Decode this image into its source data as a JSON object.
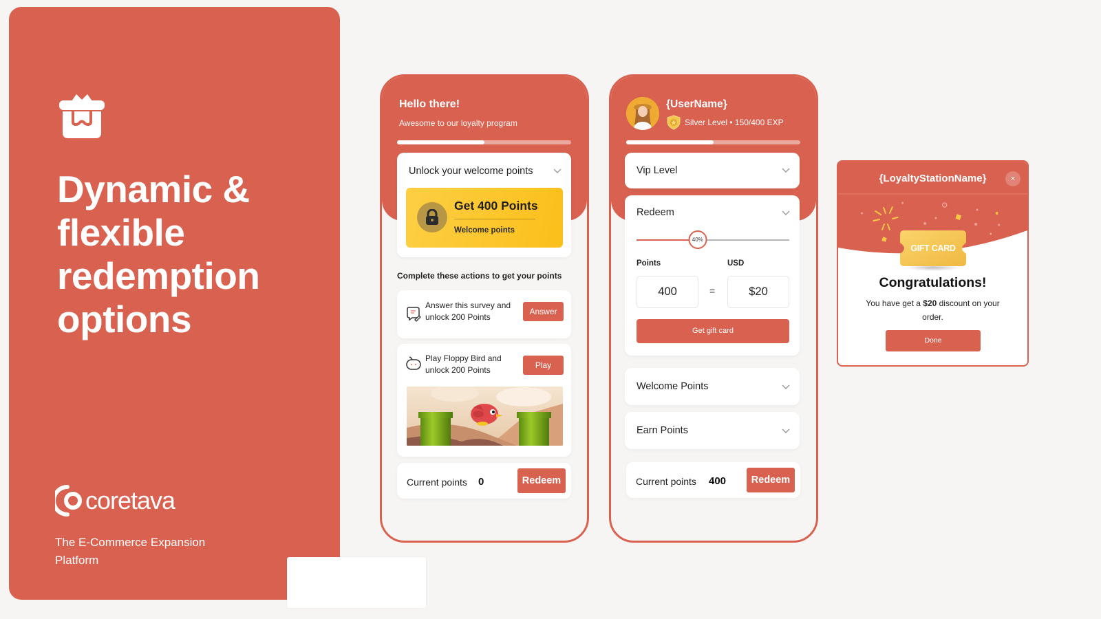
{
  "hero": {
    "icon": "gift-box-icon",
    "title": "Dynamic & flexible redemption options",
    "brand_name": "coretava",
    "brand_logo": "coretava-logo-icon",
    "tagline": "The E-Commerce Expansion Platform"
  },
  "colors": {
    "brand": "#d96150",
    "gold": "#fcc630",
    "background": "#f7f5f3"
  },
  "phone_welcome": {
    "greeting_title": "Hello there!",
    "greeting_subtitle": "Awesome to our loyalty program",
    "progress_percent": 50,
    "unlock_card": {
      "title": "Unlock your welcome points",
      "reward_title": "Get 400 Points",
      "reward_subtitle": "Welcome points",
      "icon": "lock-icon"
    },
    "actions_heading": "Complete these actions to get your points",
    "actions": [
      {
        "icon": "survey-icon",
        "text": "Answer this survey and unlock 200 Points",
        "button": "Answer"
      },
      {
        "icon": "game-controller-icon",
        "text": "Play Floppy Bird and unlock 200 Points",
        "button": "Play"
      }
    ],
    "current_points_label": "Current points",
    "current_points": "0",
    "redeem_label": "Redeem"
  },
  "phone_redeem": {
    "user_name": "{UserName}",
    "level_text": "Silver Level • 150/400 EXP",
    "exp_current": 150,
    "exp_max": 400,
    "progress_percent": 50,
    "vip_title": "Vip Level",
    "redeem_title": "Redeem",
    "slider_percent": 40,
    "slider_label": "40%",
    "points_label": "Points",
    "usd_label": "USD",
    "points_value": "400",
    "equals": "=",
    "usd_value": "$20",
    "gift_button": "Get gift card",
    "welcome_points_title": "Welcome Points",
    "earn_points_title": "Earn Points",
    "current_points_label": "Current points",
    "current_points": "400",
    "redeem_label": "Redeem"
  },
  "modal": {
    "title": "{LoyaltyStationName}",
    "close": "×",
    "gift_card_label": "GIFT CARD",
    "congrats_title": "Congratulations!",
    "message_prefix": "You have get a ",
    "message_amount": "$20",
    "message_suffix": " discount on your order.",
    "done_button": "Done"
  }
}
